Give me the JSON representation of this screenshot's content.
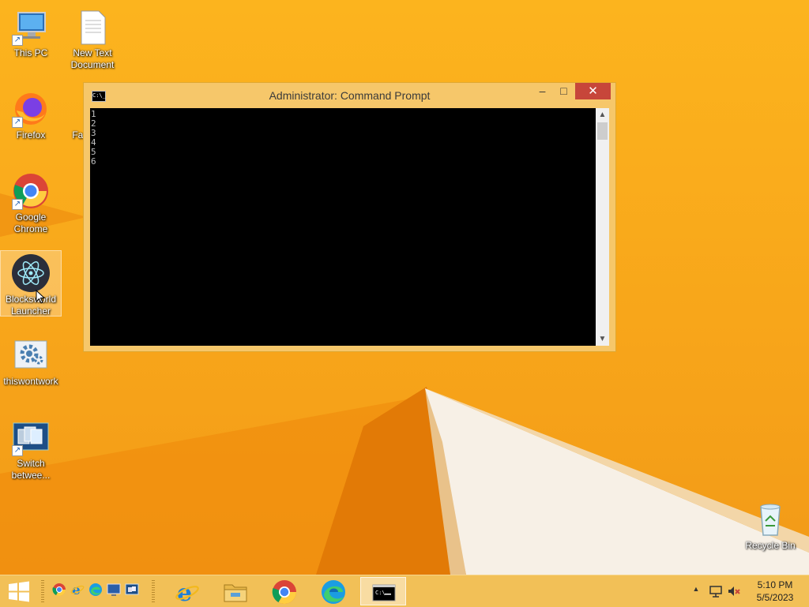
{
  "desktop": {
    "icons": [
      {
        "label": "This PC",
        "icon": "this-pc-icon"
      },
      {
        "label": "New Text Document",
        "icon": "text-document-icon"
      },
      {
        "label": "Firefox",
        "icon": "firefox-icon"
      },
      {
        "label": "Face Des",
        "icon": "recycle-like-icon"
      },
      {
        "label": "Google Chrome",
        "icon": "chrome-icon"
      },
      {
        "label": "Blocksworld Launcher",
        "icon": "electron-icon"
      },
      {
        "label": "thiswontwork",
        "icon": "settings-gear-icon"
      },
      {
        "label": "Switch betwee...",
        "icon": "switch-windows-icon"
      },
      {
        "label": "Recycle Bin",
        "icon": "recycle-bin-icon"
      }
    ]
  },
  "cmd_window": {
    "title": "Administrator:  Command Prompt",
    "app_icon_text": "C:\\_",
    "lines": [
      "1",
      "2",
      "3",
      "4",
      "5",
      "6"
    ],
    "minimize_glyph": "–",
    "maximize_glyph": "□",
    "close_glyph": "✕",
    "scroll_up_glyph": "▲",
    "scroll_down_glyph": "▼"
  },
  "taskbar": {
    "quick_launch": [
      "chrome-icon",
      "ie-icon",
      "edge-icon",
      "show-desktop-icon",
      "window-switcher-icon"
    ],
    "pinned": [
      {
        "name": "internet-explorer",
        "active": false
      },
      {
        "name": "file-explorer",
        "active": false
      },
      {
        "name": "google-chrome",
        "active": false
      },
      {
        "name": "microsoft-edge",
        "active": false
      },
      {
        "name": "command-prompt",
        "active": true
      }
    ],
    "tray_chevron": "▲",
    "clock": {
      "time": "5:10 PM",
      "date": "5/5/2023"
    }
  },
  "colors": {
    "wallpaper": "#f8a61a",
    "window_frame": "#f6c76a",
    "close_button": "#c7463a",
    "taskbar": "#f2c057"
  }
}
